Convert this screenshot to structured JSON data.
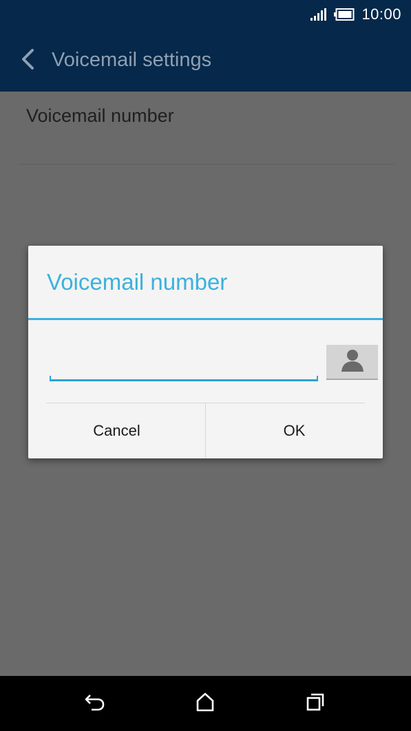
{
  "status_bar": {
    "time": "10:00",
    "icons": [
      "signal-icon",
      "battery-icon"
    ]
  },
  "app_bar": {
    "title": "Voicemail settings",
    "back_icon": "chevron-left-icon"
  },
  "settings": {
    "items": [
      {
        "label": "Voicemail number"
      }
    ]
  },
  "dialog": {
    "title": "Voicemail number",
    "input_value": "",
    "contact_icon": "person-icon",
    "cancel_label": "Cancel",
    "ok_label": "OK"
  },
  "nav_bar": {
    "icons": [
      "back-icon",
      "home-icon",
      "recents-icon"
    ]
  },
  "colors": {
    "accent": "#3bb1dd",
    "app_bar": "#06284a",
    "scrim": "#6a6a6a"
  }
}
